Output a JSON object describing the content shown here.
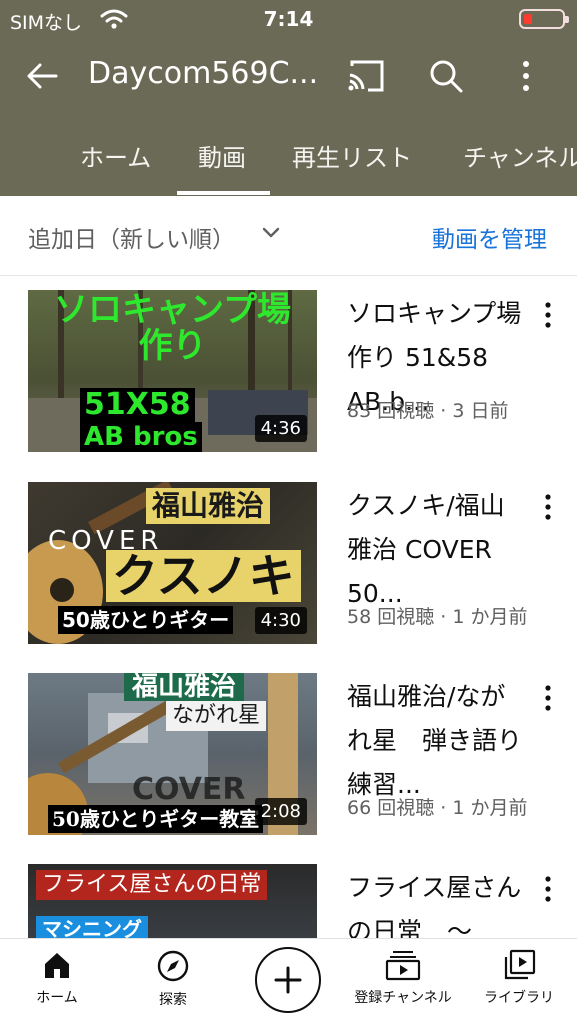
{
  "status_bar": {
    "carrier": "SIMなし",
    "time": "7:14"
  },
  "app_bar": {
    "title": "Daycom569C..."
  },
  "tabs": [
    {
      "label": "ホーム"
    },
    {
      "label": "動画"
    },
    {
      "label": "再生リスト"
    },
    {
      "label": "チャンネル"
    }
  ],
  "sort": {
    "label": "追加日（新しい順）",
    "manage": "動画を管理"
  },
  "videos": [
    {
      "title": "ソロキャンプ場作り 51&58 AB.b...",
      "meta": "83 回視聴 · 3 日前",
      "duration": "4:36",
      "thumb_text": [
        "ソロキャンプ場",
        "作り",
        "51X58",
        "AB bros"
      ]
    },
    {
      "title": "クスノキ/福山雅治 COVER　50...",
      "meta": "58 回視聴 · 1 か月前",
      "duration": "4:30",
      "thumb_text": [
        "福山雅治",
        "COVER",
        "クスノキ",
        "50歳ひとりギター"
      ]
    },
    {
      "title": "福山雅治/ながれ星　弾き語り練習...",
      "meta": "66 回視聴 · 1 か月前",
      "duration": "2:08",
      "thumb_text": [
        "福山雅治",
        "ながれ星",
        "COVER",
        "50歳ひとりギター教室"
      ]
    },
    {
      "title": "フライス屋さんの日常　〜",
      "meta": "",
      "duration": "",
      "thumb_text": [
        "フライス屋さんの日常",
        "マシニング"
      ]
    }
  ],
  "bottom_nav": [
    {
      "label": "ホーム",
      "icon": "home-icon"
    },
    {
      "label": "探索",
      "icon": "explore-icon"
    },
    {
      "label": "",
      "icon": "add-icon"
    },
    {
      "label": "登録チャンネル",
      "icon": "subscriptions-icon"
    },
    {
      "label": "ライブラリ",
      "icon": "library-icon"
    }
  ],
  "colors": {
    "header_bg": "#6b6a56",
    "accent_link": "#1a73d9",
    "battery_low": "#ff3b30"
  }
}
